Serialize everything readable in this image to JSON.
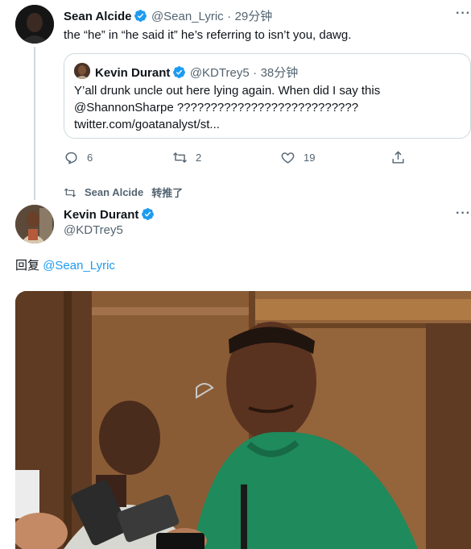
{
  "colors": {
    "accent": "#1d9bf0",
    "muted": "#536471",
    "border": "#cfd9de",
    "hoodie": "#1f8a5b"
  },
  "tweet1": {
    "name": "Sean Alcide",
    "handle": "@Sean_Lyric",
    "separator": "·",
    "time": "29分钟",
    "text": "the “he” in “he said it” he’s referring to isn’t you, dawg.",
    "quote": {
      "name": "Kevin Durant",
      "handle": "@KDTrey5",
      "separator": "·",
      "time": "38分钟",
      "line1": "Y’all drunk uncle out here lying again. When did I say this",
      "line2": "@ShannonSharpe ???????????????????????????",
      "line3": "twitter.com/goatanalyst/st..."
    },
    "actions": {
      "reply_count": "6",
      "retweet_count": "2",
      "like_count": "19"
    }
  },
  "retweet_bar": {
    "name": "Sean Alcide",
    "label": "转推了"
  },
  "tweet2": {
    "name": "Kevin Durant",
    "handle": "@KDTrey5",
    "reply_prefix": "回复",
    "reply_to": "@Sean_Lyric"
  },
  "icons": {
    "reply": "reply-icon",
    "retweet": "retweet-icon",
    "like": "heart-icon",
    "share": "share-icon",
    "verified": "verified-badge-icon",
    "more": "more-icon"
  }
}
